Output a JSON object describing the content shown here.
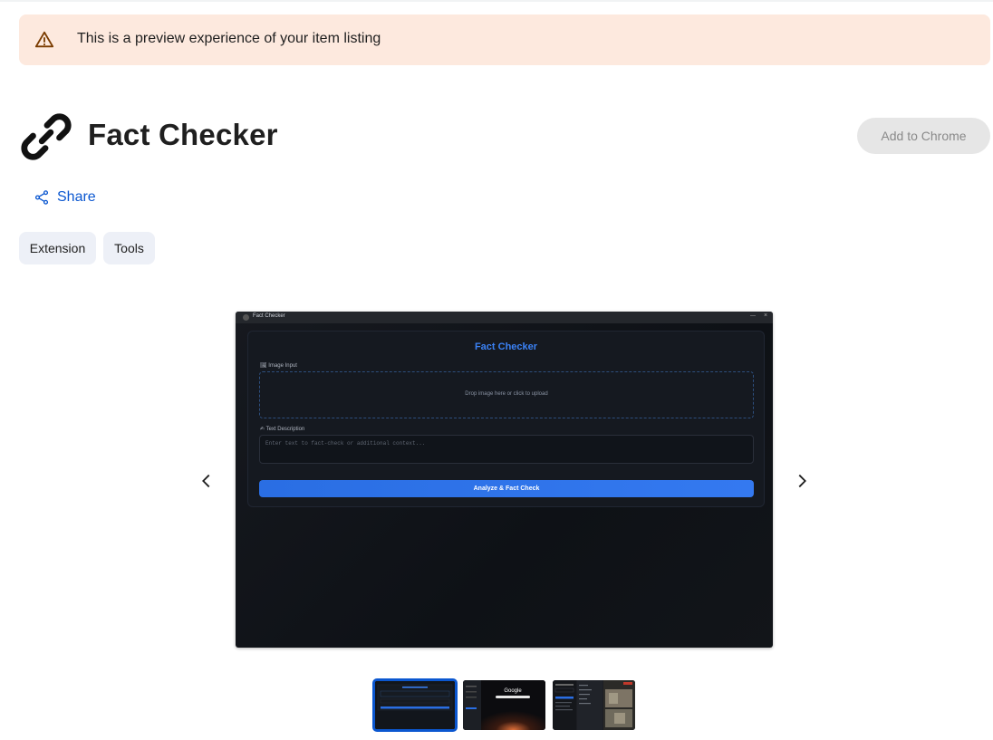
{
  "banner": {
    "text": "This is a preview experience of your item listing",
    "icon": "warning-icon"
  },
  "header": {
    "title": "Fact Checker",
    "logo_icon": "chain-link-icon",
    "add_button_label": "Add to Chrome"
  },
  "share": {
    "label": "Share",
    "icon": "share-icon"
  },
  "tags": [
    "Extension",
    "Tools"
  ],
  "carousel": {
    "prev_icon": "chevron-left-icon",
    "next_icon": "chevron-right-icon",
    "selected_index": 0,
    "thumbnail_count": 3,
    "screenshot": {
      "window_title": "Fact Checker",
      "app_title": "Fact Checker",
      "image_label": "🖼 Image Input",
      "drop_text": "Drop image here or click to upload",
      "text_label": "✍ Text Description",
      "text_placeholder": "Enter text to fact-check or additional context...",
      "button_label": "Analyze & Fact Check"
    },
    "thumb2_text": "Google"
  },
  "colors": {
    "banner_bg": "#fde9de",
    "link": "#0b57d0",
    "accent_blue": "#3b82f6",
    "chip_bg": "#edf0f7"
  }
}
